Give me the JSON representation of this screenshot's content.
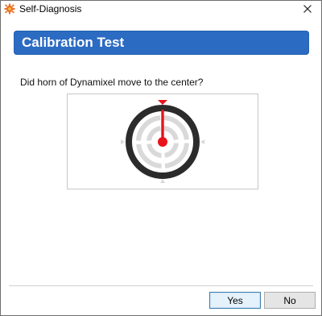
{
  "window": {
    "title": "Self-Diagnosis",
    "close_glyph": "✕"
  },
  "banner": {
    "title": "Calibration Test",
    "color": "#2c6bc2"
  },
  "question": "Did horn of Dynamixel move to the center?",
  "diagram": {
    "icon": "dynamixel-horn-center-icon",
    "needle_color": "#e8131b",
    "ring_color": "#2b2b2b"
  },
  "buttons": {
    "yes": "Yes",
    "no": "No"
  }
}
